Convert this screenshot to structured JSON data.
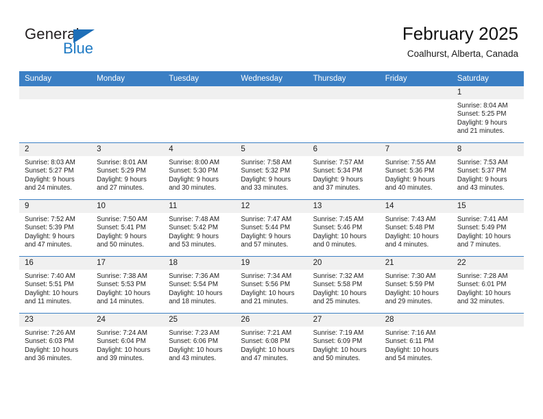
{
  "brand": {
    "name_part1": "General",
    "name_part2": "Blue",
    "triangle_color": "#1e6fb8",
    "blue_color": "#1f7ac4"
  },
  "header": {
    "title": "February 2025",
    "subtitle": "Coalhurst, Alberta, Canada",
    "accent_color": "#3b7fc4",
    "daynum_band_color": "#f0f0f0"
  },
  "weekday_headers": [
    "Sunday",
    "Monday",
    "Tuesday",
    "Wednesday",
    "Thursday",
    "Friday",
    "Saturday"
  ],
  "labels": {
    "sunrise": "Sunrise:",
    "sunset": "Sunset:",
    "daylight": "Daylight:"
  },
  "weeks": [
    [
      {
        "day": "",
        "empty": true
      },
      {
        "day": "",
        "empty": true
      },
      {
        "day": "",
        "empty": true
      },
      {
        "day": "",
        "empty": true
      },
      {
        "day": "",
        "empty": true
      },
      {
        "day": "",
        "empty": true
      },
      {
        "day": "1",
        "sunrise": "Sunrise: 8:04 AM",
        "sunset": "Sunset: 5:25 PM",
        "daylight_line1": "Daylight: 9 hours",
        "daylight_line2": "and 21 minutes."
      }
    ],
    [
      {
        "day": "2",
        "sunrise": "Sunrise: 8:03 AM",
        "sunset": "Sunset: 5:27 PM",
        "daylight_line1": "Daylight: 9 hours",
        "daylight_line2": "and 24 minutes."
      },
      {
        "day": "3",
        "sunrise": "Sunrise: 8:01 AM",
        "sunset": "Sunset: 5:29 PM",
        "daylight_line1": "Daylight: 9 hours",
        "daylight_line2": "and 27 minutes."
      },
      {
        "day": "4",
        "sunrise": "Sunrise: 8:00 AM",
        "sunset": "Sunset: 5:30 PM",
        "daylight_line1": "Daylight: 9 hours",
        "daylight_line2": "and 30 minutes."
      },
      {
        "day": "5",
        "sunrise": "Sunrise: 7:58 AM",
        "sunset": "Sunset: 5:32 PM",
        "daylight_line1": "Daylight: 9 hours",
        "daylight_line2": "and 33 minutes."
      },
      {
        "day": "6",
        "sunrise": "Sunrise: 7:57 AM",
        "sunset": "Sunset: 5:34 PM",
        "daylight_line1": "Daylight: 9 hours",
        "daylight_line2": "and 37 minutes."
      },
      {
        "day": "7",
        "sunrise": "Sunrise: 7:55 AM",
        "sunset": "Sunset: 5:36 PM",
        "daylight_line1": "Daylight: 9 hours",
        "daylight_line2": "and 40 minutes."
      },
      {
        "day": "8",
        "sunrise": "Sunrise: 7:53 AM",
        "sunset": "Sunset: 5:37 PM",
        "daylight_line1": "Daylight: 9 hours",
        "daylight_line2": "and 43 minutes."
      }
    ],
    [
      {
        "day": "9",
        "sunrise": "Sunrise: 7:52 AM",
        "sunset": "Sunset: 5:39 PM",
        "daylight_line1": "Daylight: 9 hours",
        "daylight_line2": "and 47 minutes."
      },
      {
        "day": "10",
        "sunrise": "Sunrise: 7:50 AM",
        "sunset": "Sunset: 5:41 PM",
        "daylight_line1": "Daylight: 9 hours",
        "daylight_line2": "and 50 minutes."
      },
      {
        "day": "11",
        "sunrise": "Sunrise: 7:48 AM",
        "sunset": "Sunset: 5:42 PM",
        "daylight_line1": "Daylight: 9 hours",
        "daylight_line2": "and 53 minutes."
      },
      {
        "day": "12",
        "sunrise": "Sunrise: 7:47 AM",
        "sunset": "Sunset: 5:44 PM",
        "daylight_line1": "Daylight: 9 hours",
        "daylight_line2": "and 57 minutes."
      },
      {
        "day": "13",
        "sunrise": "Sunrise: 7:45 AM",
        "sunset": "Sunset: 5:46 PM",
        "daylight_line1": "Daylight: 10 hours",
        "daylight_line2": "and 0 minutes."
      },
      {
        "day": "14",
        "sunrise": "Sunrise: 7:43 AM",
        "sunset": "Sunset: 5:48 PM",
        "daylight_line1": "Daylight: 10 hours",
        "daylight_line2": "and 4 minutes."
      },
      {
        "day": "15",
        "sunrise": "Sunrise: 7:41 AM",
        "sunset": "Sunset: 5:49 PM",
        "daylight_line1": "Daylight: 10 hours",
        "daylight_line2": "and 7 minutes."
      }
    ],
    [
      {
        "day": "16",
        "sunrise": "Sunrise: 7:40 AM",
        "sunset": "Sunset: 5:51 PM",
        "daylight_line1": "Daylight: 10 hours",
        "daylight_line2": "and 11 minutes."
      },
      {
        "day": "17",
        "sunrise": "Sunrise: 7:38 AM",
        "sunset": "Sunset: 5:53 PM",
        "daylight_line1": "Daylight: 10 hours",
        "daylight_line2": "and 14 minutes."
      },
      {
        "day": "18",
        "sunrise": "Sunrise: 7:36 AM",
        "sunset": "Sunset: 5:54 PM",
        "daylight_line1": "Daylight: 10 hours",
        "daylight_line2": "and 18 minutes."
      },
      {
        "day": "19",
        "sunrise": "Sunrise: 7:34 AM",
        "sunset": "Sunset: 5:56 PM",
        "daylight_line1": "Daylight: 10 hours",
        "daylight_line2": "and 21 minutes."
      },
      {
        "day": "20",
        "sunrise": "Sunrise: 7:32 AM",
        "sunset": "Sunset: 5:58 PM",
        "daylight_line1": "Daylight: 10 hours",
        "daylight_line2": "and 25 minutes."
      },
      {
        "day": "21",
        "sunrise": "Sunrise: 7:30 AM",
        "sunset": "Sunset: 5:59 PM",
        "daylight_line1": "Daylight: 10 hours",
        "daylight_line2": "and 29 minutes."
      },
      {
        "day": "22",
        "sunrise": "Sunrise: 7:28 AM",
        "sunset": "Sunset: 6:01 PM",
        "daylight_line1": "Daylight: 10 hours",
        "daylight_line2": "and 32 minutes."
      }
    ],
    [
      {
        "day": "23",
        "sunrise": "Sunrise: 7:26 AM",
        "sunset": "Sunset: 6:03 PM",
        "daylight_line1": "Daylight: 10 hours",
        "daylight_line2": "and 36 minutes."
      },
      {
        "day": "24",
        "sunrise": "Sunrise: 7:24 AM",
        "sunset": "Sunset: 6:04 PM",
        "daylight_line1": "Daylight: 10 hours",
        "daylight_line2": "and 39 minutes."
      },
      {
        "day": "25",
        "sunrise": "Sunrise: 7:23 AM",
        "sunset": "Sunset: 6:06 PM",
        "daylight_line1": "Daylight: 10 hours",
        "daylight_line2": "and 43 minutes."
      },
      {
        "day": "26",
        "sunrise": "Sunrise: 7:21 AM",
        "sunset": "Sunset: 6:08 PM",
        "daylight_line1": "Daylight: 10 hours",
        "daylight_line2": "and 47 minutes."
      },
      {
        "day": "27",
        "sunrise": "Sunrise: 7:19 AM",
        "sunset": "Sunset: 6:09 PM",
        "daylight_line1": "Daylight: 10 hours",
        "daylight_line2": "and 50 minutes."
      },
      {
        "day": "28",
        "sunrise": "Sunrise: 7:16 AM",
        "sunset": "Sunset: 6:11 PM",
        "daylight_line1": "Daylight: 10 hours",
        "daylight_line2": "and 54 minutes."
      },
      {
        "day": "",
        "empty": true
      }
    ]
  ]
}
